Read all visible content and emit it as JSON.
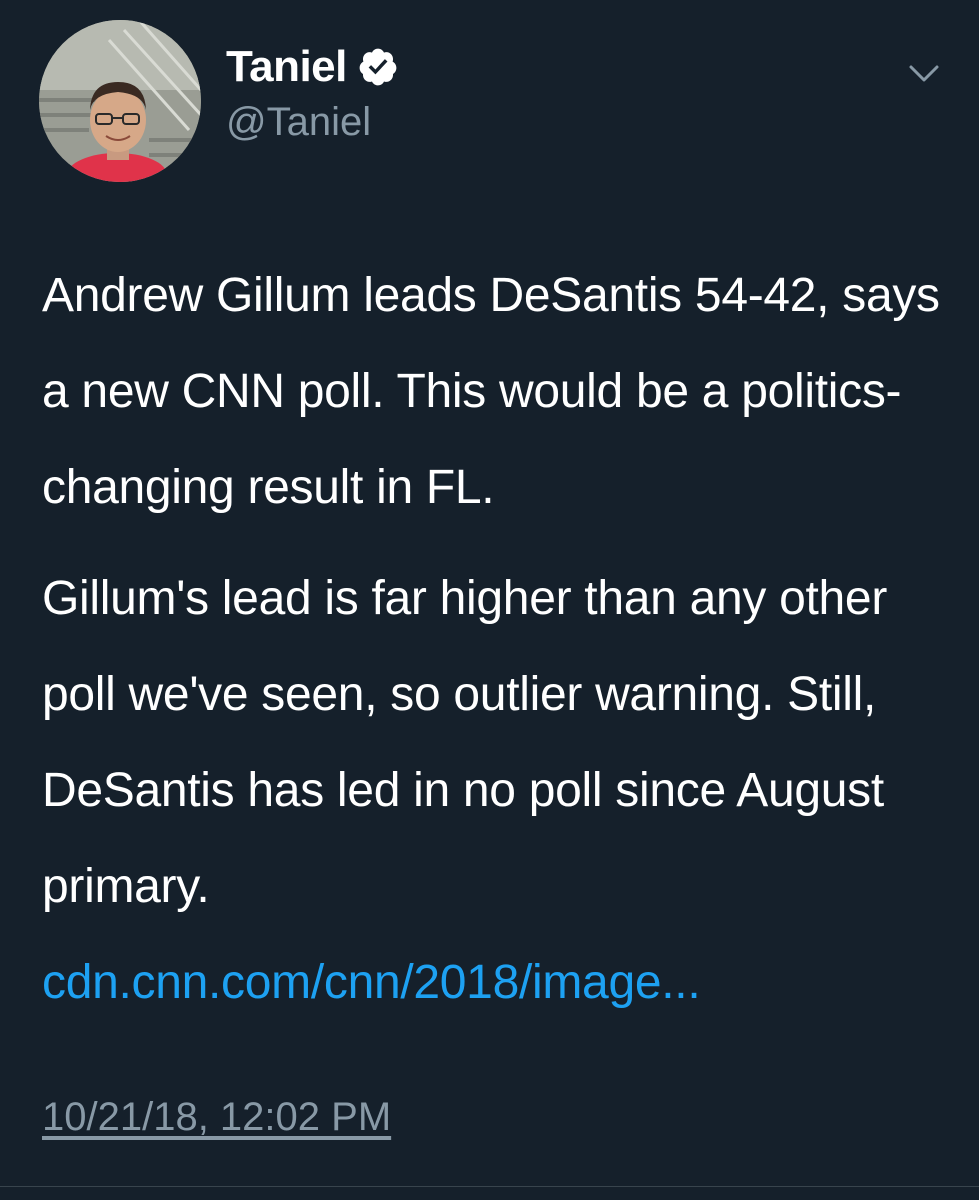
{
  "tweet": {
    "author": {
      "display_name": "Taniel",
      "handle": "@Taniel",
      "verified": true,
      "avatar_icon": "profile-photo"
    },
    "paragraphs": [
      "Andrew Gillum leads DeSantis 54-42, says a new CNN poll. This would be a politics-changing result in FL.",
      "Gillum's lead is far higher than any other poll we've seen, so outlier warning. Still, DeSantis has led in no poll since August primary."
    ],
    "link_text": "cdn.cnn.com/cnn/2018/image...",
    "timestamp": "10/21/18, 12:02 PM",
    "menu_icon": "chevron-down-icon"
  },
  "colors": {
    "background": "#15202b",
    "text": "#ffffff",
    "secondary": "#8899a6",
    "link": "#1da1f2",
    "verified": "#ffffff"
  }
}
